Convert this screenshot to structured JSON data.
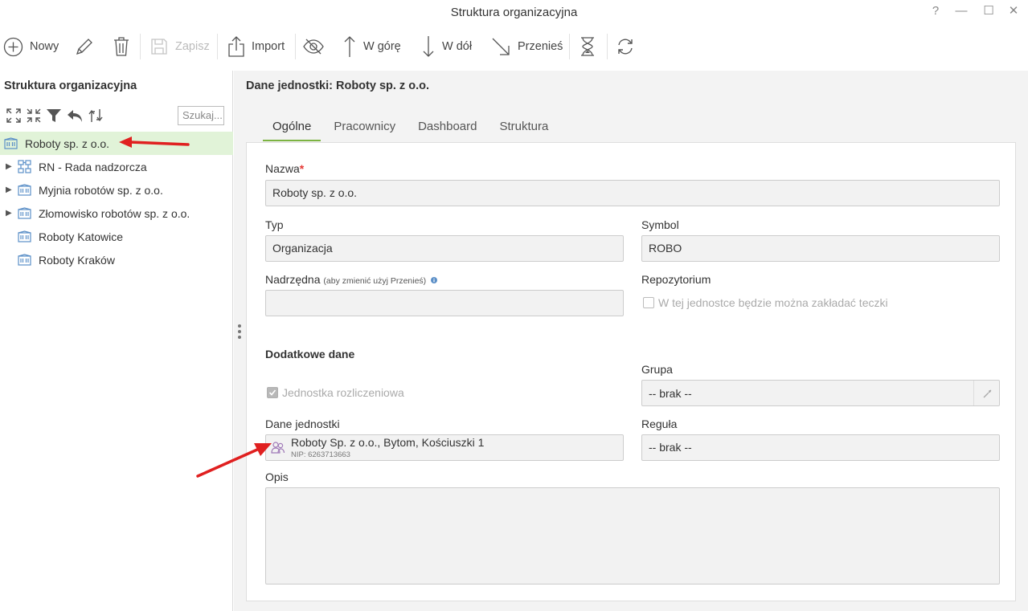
{
  "window": {
    "title": "Struktura organizacyjna",
    "help": "?",
    "minimize": "—",
    "maximize": "☐",
    "close": "✕"
  },
  "toolbar": {
    "new_label": "Nowy",
    "save_label": "Zapisz",
    "import_label": "Import",
    "up_label": "W górę",
    "down_label": "W dół",
    "move_label": "Przenieś"
  },
  "left": {
    "title": "Struktura organizacyjna",
    "search_placeholder": "Szukaj...",
    "tree": [
      {
        "label": "Roboty sp. z o.o.",
        "icon": "building-icon",
        "selected": true,
        "expandable": false
      },
      {
        "label": "RN - Rada nadzorcza",
        "icon": "org-chart-icon",
        "selected": false,
        "expandable": true
      },
      {
        "label": "Myjnia robotów sp. z o.o.",
        "icon": "building-icon",
        "selected": false,
        "expandable": true
      },
      {
        "label": "Złomowisko robotów sp. z o.o.",
        "icon": "building-icon",
        "selected": false,
        "expandable": true
      },
      {
        "label": "Roboty Katowice",
        "icon": "building-icon",
        "selected": false,
        "expandable": false
      },
      {
        "label": "Roboty Kraków",
        "icon": "building-icon",
        "selected": false,
        "expandable": false
      }
    ]
  },
  "right": {
    "heading": "Dane jednostki: Roboty sp. z o.o.",
    "tabs": [
      {
        "label": "Ogólne",
        "active": true
      },
      {
        "label": "Pracownicy",
        "active": false
      },
      {
        "label": "Dashboard",
        "active": false
      },
      {
        "label": "Struktura",
        "active": false
      }
    ],
    "form": {
      "name_label": "Nazwa",
      "name_required": "*",
      "name_value": "Roboty sp. z o.o.",
      "type_label": "Typ",
      "type_value": "Organizacja",
      "symbol_label": "Symbol",
      "symbol_value": "ROBO",
      "parent_label": "Nadrzędna",
      "parent_hint": "(aby zmienić użyj Przenieś)",
      "parent_value": "",
      "repo_label": "Repozytorium",
      "repo_checkbox": "W tej jednostce będzie można zakładać teczki",
      "repo_checked": false,
      "extra_section": "Dodatkowe dane",
      "billing_checkbox": "Jednostka rozliczeniowa",
      "billing_checked": true,
      "group_label": "Grupa",
      "group_value": "-- brak --",
      "unit_data_label": "Dane jednostki",
      "unit_data_value": "Roboty Sp. z o.o., Bytom, Kościuszki 1",
      "unit_data_nip": "NIP: 6263713663",
      "rule_label": "Reguła",
      "rule_value": "-- brak --",
      "desc_label": "Opis",
      "desc_value": ""
    }
  },
  "colors": {
    "accent_green": "#7cb342",
    "selected_bg": "#e1f3d8",
    "annotation_red": "#e02020",
    "icon_blue": "#5b8fc7"
  }
}
